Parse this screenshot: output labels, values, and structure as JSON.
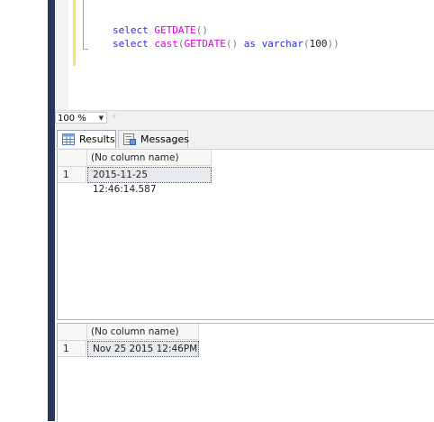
{
  "editor": {
    "lines": [
      {
        "kw1": "select",
        "fn1": "GETDATE",
        "p1": "()",
        "kw2": "",
        "p2": "",
        "fn2": "",
        "p3": "",
        "kw3": "",
        "kw4": "",
        "p4": "",
        "num": "",
        "p5": ""
      },
      {
        "kw1": "select",
        "fn1": "cast",
        "p1": "(",
        "fn2": "GETDATE",
        "p2": "()",
        "kw2": "as",
        "kw3": "varchar",
        "p3": "(",
        "num": "100",
        "p4": "))"
      }
    ]
  },
  "zoom": {
    "value": "100 %"
  },
  "tabs": {
    "results": "Results",
    "messages": "Messages"
  },
  "grids": [
    {
      "column_header": "(No column name)",
      "row_number": "1",
      "value": "2015-11-25 12:46:14.587"
    },
    {
      "column_header": "(No column name)",
      "row_number": "1",
      "value": "Nov 25 2015 12:46PM"
    }
  ],
  "colors": {
    "keyword": "#2d2dd8",
    "function": "#d600d6",
    "punctuation": "#808080",
    "frame": "#293955"
  }
}
